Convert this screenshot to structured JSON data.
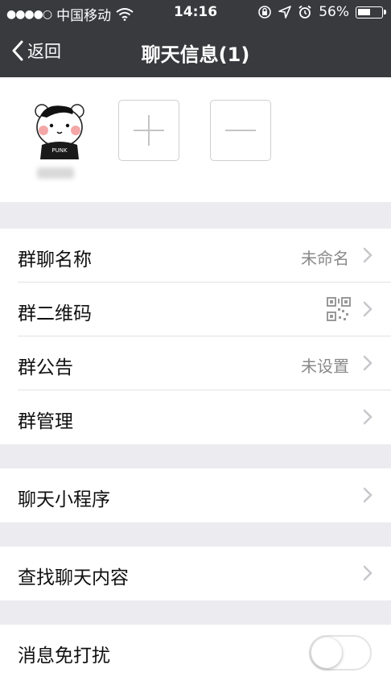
{
  "status_bar": {
    "signal_dots": "●●●●○",
    "carrier": "中国移动",
    "time": "14:16",
    "battery_percent": "56%",
    "battery_level": 0.56
  },
  "nav": {
    "back_label": "返回",
    "title": "聊天信息(1)"
  },
  "members": {
    "avatar_caption": "PUNK"
  },
  "group1": {
    "items": [
      {
        "label": "群聊名称",
        "value": "未命名"
      },
      {
        "label": "群二维码",
        "value": ""
      },
      {
        "label": "群公告",
        "value": "未设置"
      },
      {
        "label": "群管理",
        "value": ""
      }
    ]
  },
  "group2": {
    "items": [
      {
        "label": "聊天小程序"
      }
    ]
  },
  "group3": {
    "items": [
      {
        "label": "查找聊天内容"
      }
    ]
  },
  "group4": {
    "items": [
      {
        "label": "消息免打扰",
        "toggle_on": false
      }
    ]
  },
  "colors": {
    "header_bg": "#393a3e",
    "page_bg": "#ebebf0"
  }
}
